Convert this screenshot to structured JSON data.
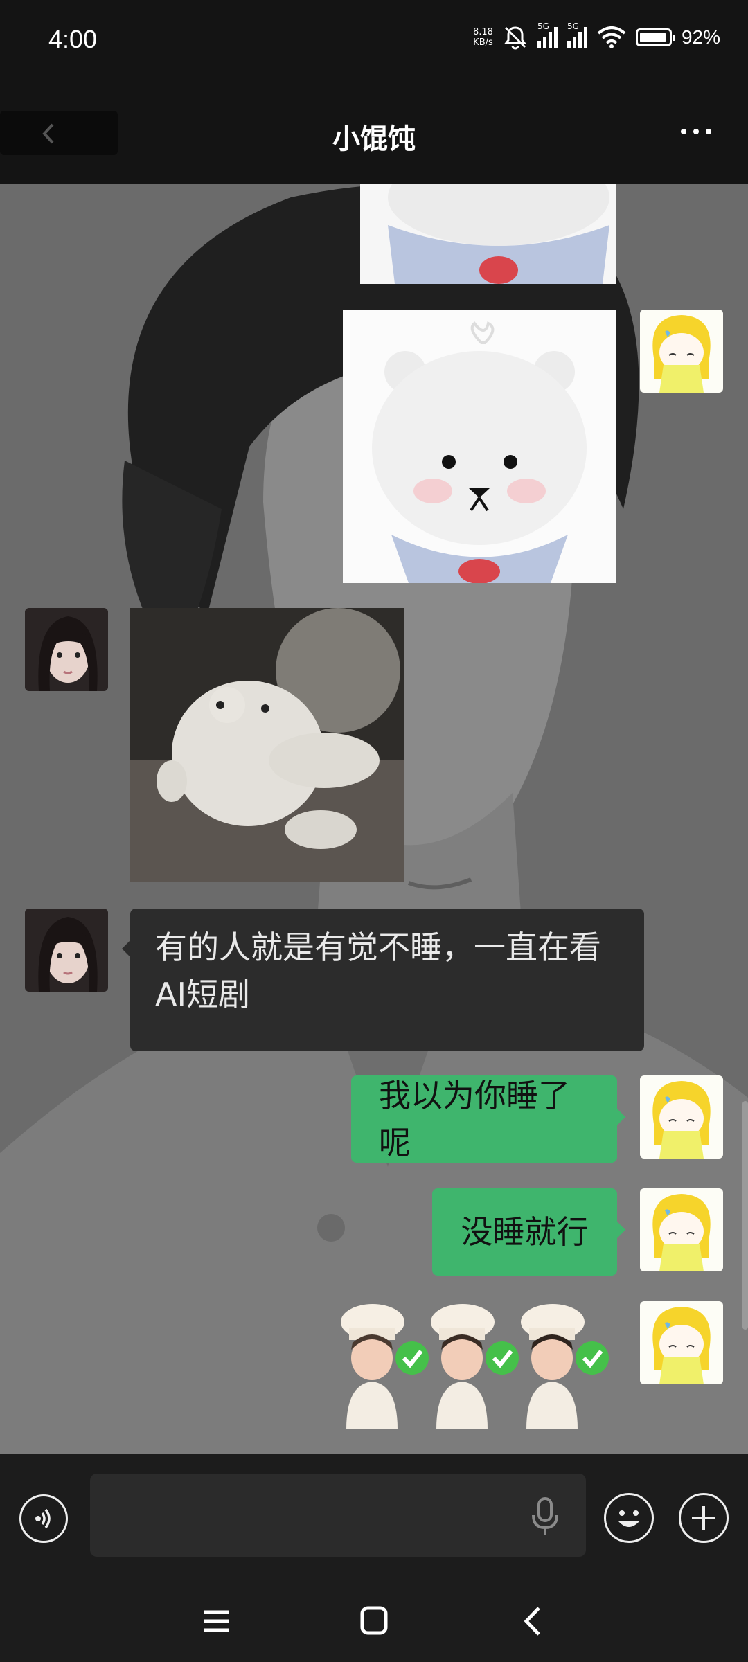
{
  "status_bar": {
    "time": "4:00",
    "net_speed_value": "8.18",
    "net_speed_unit": "KB/s",
    "sim1_label": "5G",
    "sim2_label": "5G",
    "battery_percent": "92%",
    "battery_level": 0.92,
    "icons": [
      "mute-bell-icon",
      "signal-icon",
      "wifi-icon",
      "battery-icon"
    ]
  },
  "header": {
    "title": "小馄饨",
    "back_icon": "chevron-left-icon",
    "more_icon": "more-dots-icon"
  },
  "messages": [
    {
      "sender": "me",
      "type": "image",
      "desc": "white bear plush (partially scrolled)"
    },
    {
      "sender": "me",
      "type": "image",
      "desc": "white bear plush sticker"
    },
    {
      "sender": "other",
      "type": "image",
      "desc": "plush bear lying photo"
    },
    {
      "sender": "other",
      "type": "text",
      "line1": "有的人就是有觉不睡，一直在看",
      "line2": "AI短剧"
    },
    {
      "sender": "me",
      "type": "text",
      "text": "我以为你睡了呢"
    },
    {
      "sender": "me",
      "type": "text",
      "text": "没睡就行"
    },
    {
      "sender": "me",
      "type": "sticker",
      "desc": "three chef figures with check marks"
    }
  ],
  "input_bar": {
    "placeholder": "",
    "icons": [
      "voice-icon",
      "microphone-icon",
      "emoji-icon",
      "plus-icon"
    ]
  },
  "nav_bar": {
    "icons": [
      "menu-icon",
      "home-square-icon",
      "back-chevron-icon"
    ]
  },
  "colors": {
    "my_bubble": "#3fb56d",
    "other_bubble": "#2c2c2c",
    "bar_bg": "#1c1c1c",
    "header_bg": "#141414"
  }
}
